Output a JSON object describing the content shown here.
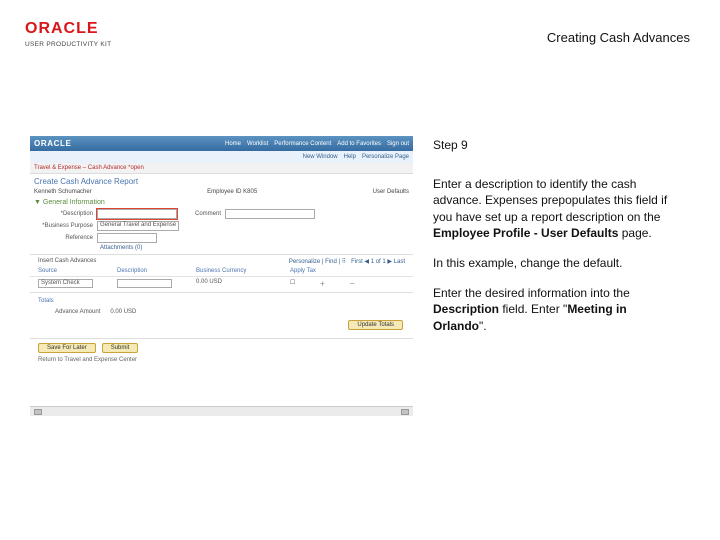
{
  "header": {
    "logo_text": "ORACLE",
    "logo_sub": "USER PRODUCTIVITY KIT",
    "title": "Creating Cash Advances"
  },
  "screenshot": {
    "brand": "ORACLE",
    "mininav": [
      "Home",
      "Worklist",
      "Performance Content",
      "Add to Favorites",
      "Sign out"
    ],
    "crumb_left": "New Window",
    "crumb_mid": "Help",
    "crumb_right": "Personalize Page",
    "tab": "Travel & Expense – Cash Advance *open",
    "h1": "Create Cash Advance Report",
    "name": "Kenneth Schumacher",
    "empid_lbl": "Employee ID",
    "empid_val": "K805",
    "userdef": "User Defaults",
    "section": "▼ General Information",
    "desc_lbl": "*Description",
    "purpose_lbl": "*Business Purpose",
    "purpose_val": "General Travel and Expense",
    "ref_lbl": "Reference",
    "comment_lbl": "Comment",
    "attach": "Attachments (0)",
    "grid_title": "Insert Cash Advances",
    "grid_find": "Personalize | Find  | ⠿",
    "grid_count": "First ◀ 1 of 1 ▶ Last",
    "col1": "Source",
    "col2": "Description",
    "col3": "Business Currency",
    "col4": "Apply Tax",
    "row_src": "System Check",
    "row_amt": "0.00 USD",
    "totals": "Totals",
    "adv_lbl": "Advance Amount",
    "adv_val": "0.00   USD",
    "updatetotals": "Update Totals",
    "save": "Save For Later",
    "submit": "Submit",
    "hint": "Return to Travel and Expense Center"
  },
  "instructions": {
    "step": "Step 9",
    "p1a": "Enter a description to identify the cash advance. Expenses prepopulates this field if you have set up a report description on the ",
    "p1b": "Employee Profile - User Defaults",
    "p1c": " page.",
    "p2": "In this example, change the default.",
    "p3a": "Enter the desired information into the ",
    "p3b": "Description",
    "p3c": " field. Enter \"",
    "p3d": "Meeting in Orlando",
    "p3e": "\"."
  }
}
